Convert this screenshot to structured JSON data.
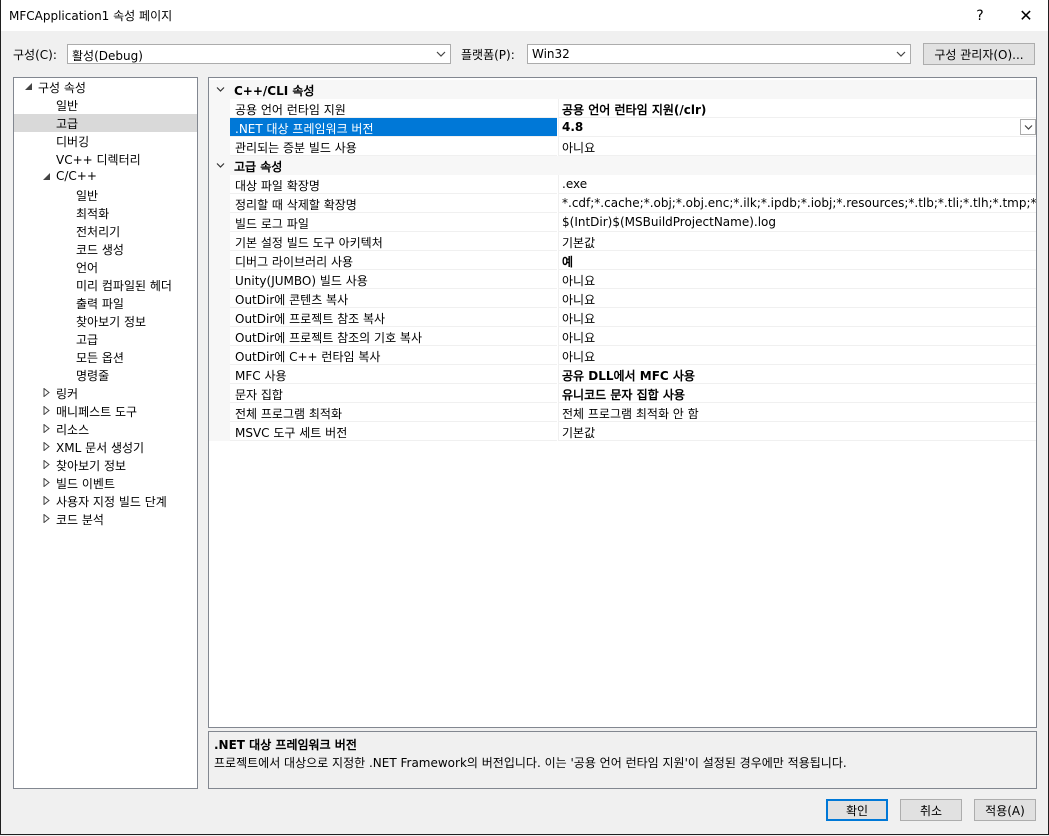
{
  "window": {
    "title": "MFCApplication1 속성 페이지",
    "help_glyph": "?",
    "close_glyph": "✕"
  },
  "config": {
    "config_label": "구성(C):",
    "config_value": "활성(Debug)",
    "platform_label": "플랫폼(P):",
    "platform_value": "Win32",
    "manager_button": "구성 관리자(O)..."
  },
  "tree": [
    {
      "label": "구성 속성",
      "level": 0,
      "toggle": "expanded"
    },
    {
      "label": "일반",
      "level": 1
    },
    {
      "label": "고급",
      "level": 1,
      "selected": true
    },
    {
      "label": "디버깅",
      "level": 1
    },
    {
      "label": "VC++ 디렉터리",
      "level": 1
    },
    {
      "label": "C/C++",
      "level": 1,
      "toggle": "expanded"
    },
    {
      "label": "일반",
      "level": 2
    },
    {
      "label": "최적화",
      "level": 2
    },
    {
      "label": "전처리기",
      "level": 2
    },
    {
      "label": "코드 생성",
      "level": 2
    },
    {
      "label": "언어",
      "level": 2
    },
    {
      "label": "미리 컴파일된 헤더",
      "level": 2
    },
    {
      "label": "출력 파일",
      "level": 2
    },
    {
      "label": "찾아보기 정보",
      "level": 2
    },
    {
      "label": "고급",
      "level": 2
    },
    {
      "label": "모든 옵션",
      "level": 2
    },
    {
      "label": "명령줄",
      "level": 2
    },
    {
      "label": "링커",
      "level": 1,
      "toggle": "collapsed"
    },
    {
      "label": "매니페스트 도구",
      "level": 1,
      "toggle": "collapsed"
    },
    {
      "label": "리소스",
      "level": 1,
      "toggle": "collapsed"
    },
    {
      "label": "XML 문서 생성기",
      "level": 1,
      "toggle": "collapsed"
    },
    {
      "label": "찾아보기 정보",
      "level": 1,
      "toggle": "collapsed"
    },
    {
      "label": "빌드 이벤트",
      "level": 1,
      "toggle": "collapsed"
    },
    {
      "label": "사용자 지정 빌드 단계",
      "level": 1,
      "toggle": "collapsed"
    },
    {
      "label": "코드 분석",
      "level": 1,
      "toggle": "collapsed"
    }
  ],
  "grid": [
    {
      "type": "category",
      "label": "C++/CLI 속성"
    },
    {
      "type": "prop",
      "name": "공용 언어 런타임 지원",
      "value": "공용 언어 런타임 지원(/clr)",
      "bold": true
    },
    {
      "type": "prop",
      "name": ".NET 대상 프레임워크 버전",
      "value": "4.8",
      "bold": true,
      "selected": true
    },
    {
      "type": "prop",
      "name": "관리되는 증분 빌드 사용",
      "value": "아니요"
    },
    {
      "type": "category",
      "label": "고급 속성"
    },
    {
      "type": "prop",
      "name": "대상 파일 확장명",
      "value": ".exe"
    },
    {
      "type": "prop",
      "name": "정리할 때 삭제할 확장명",
      "value": "*.cdf;*.cache;*.obj;*.obj.enc;*.ilk;*.ipdb;*.iobj;*.resources;*.tlb;*.tli;*.tlh;*.tmp;*.rsp;*.pgc;*.p"
    },
    {
      "type": "prop",
      "name": "빌드 로그 파일",
      "value": "$(IntDir)$(MSBuildProjectName).log"
    },
    {
      "type": "prop",
      "name": "기본 설정 빌드 도구 아키텍처",
      "value": "기본값"
    },
    {
      "type": "prop",
      "name": "디버그 라이브러리 사용",
      "value": "예",
      "bold": true
    },
    {
      "type": "prop",
      "name": "Unity(JUMBO) 빌드 사용",
      "value": "아니요"
    },
    {
      "type": "prop",
      "name": "OutDir에 콘텐츠 복사",
      "value": "아니요"
    },
    {
      "type": "prop",
      "name": "OutDir에 프로젝트 참조 복사",
      "value": "아니요"
    },
    {
      "type": "prop",
      "name": "OutDir에 프로젝트 참조의 기호 복사",
      "value": "아니요"
    },
    {
      "type": "prop",
      "name": "OutDir에 C++ 런타임 복사",
      "value": "아니요"
    },
    {
      "type": "prop",
      "name": "MFC 사용",
      "value": "공유 DLL에서 MFC 사용",
      "bold": true
    },
    {
      "type": "prop",
      "name": "문자 집합",
      "value": "유니코드 문자 집합 사용",
      "bold": true
    },
    {
      "type": "prop",
      "name": "전체 프로그램 최적화",
      "value": "전체 프로그램 최적화 안 함"
    },
    {
      "type": "prop",
      "name": "MSVC 도구 세트 버전",
      "value": "기본값"
    }
  ],
  "description": {
    "title": ".NET 대상 프레임워크 버전",
    "text": "프로젝트에서 대상으로 지정한 .NET Framework의 버전입니다. 이는 '공용 언어 런타임 지원'이 설정된 경우에만 적용됩니다."
  },
  "buttons": {
    "ok": "확인",
    "cancel": "취소",
    "apply": "적용(A)"
  },
  "colors": {
    "selection": "#0078d7",
    "tree_selection": "#d9d9d9",
    "category_bg": "#f7f7f7"
  }
}
